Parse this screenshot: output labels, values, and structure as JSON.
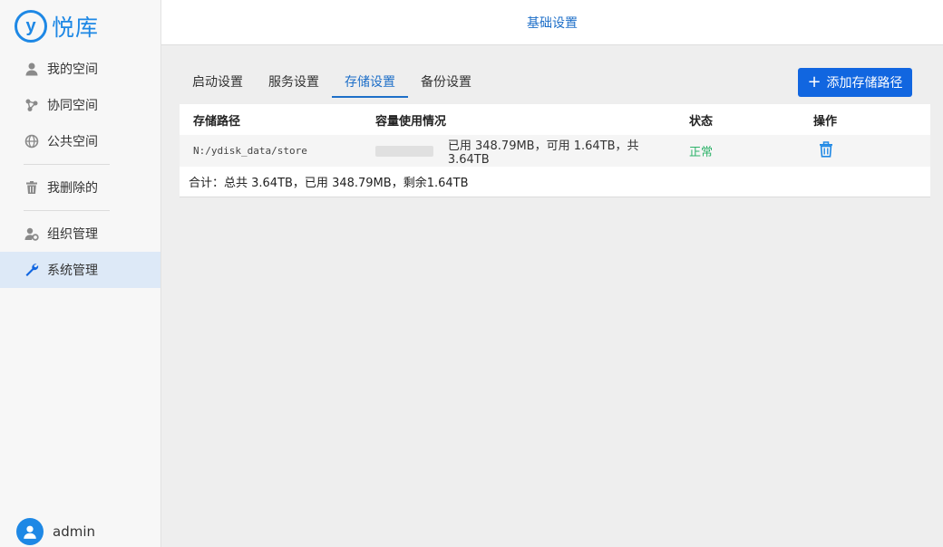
{
  "app": {
    "logo_text": "悦库",
    "logo_mark": "y"
  },
  "sidebar": {
    "items": [
      {
        "label": "我的空间",
        "icon": "person-icon"
      },
      {
        "label": "协同空间",
        "icon": "share-icon"
      },
      {
        "label": "公共空间",
        "icon": "globe-icon"
      },
      {
        "label": "我删除的",
        "icon": "trash-icon"
      },
      {
        "label": "组织管理",
        "icon": "user-settings-icon"
      },
      {
        "label": "系统管理",
        "icon": "wrench-icon",
        "active": true
      }
    ],
    "user": "admin"
  },
  "header": {
    "title": "基础设置"
  },
  "tabs": [
    {
      "label": "启动设置"
    },
    {
      "label": "服务设置"
    },
    {
      "label": "存储设置",
      "active": true
    },
    {
      "label": "备份设置"
    }
  ],
  "add_button": {
    "label": "添加存储路径"
  },
  "table": {
    "columns": [
      "存储路径",
      "容量使用情况",
      "状态",
      "操作"
    ],
    "rows": [
      {
        "path": "N:/ydisk_data/store",
        "usage_fraction": 0.0001,
        "usage_text": "已用 348.79MB，可用 1.64TB，共 3.64TB",
        "status": "正常"
      }
    ],
    "summary": "合计：总共 3.64TB，已用 348.79MB，剩余1.64TB"
  },
  "colors": {
    "accent": "#1166e0",
    "link": "#1e6fc8",
    "ok": "#2fb36a"
  }
}
